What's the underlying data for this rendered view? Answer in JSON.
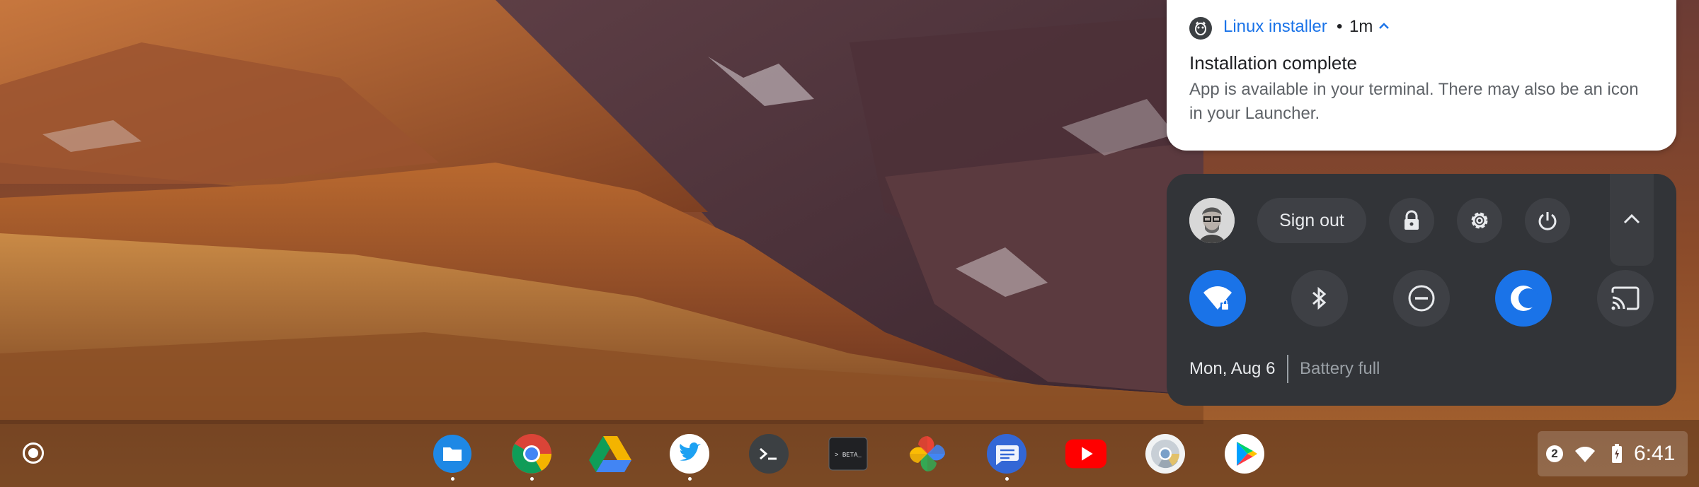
{
  "wallpaper": {
    "description_colors": [
      "#8a4a24",
      "#5a3530",
      "#c98246"
    ]
  },
  "notification": {
    "app_name": "Linux installer",
    "separator": "•",
    "time": "1m",
    "title": "Installation complete",
    "body": "App is available in your terminal. There may also be an icon in your Launcher.",
    "accent": "#1a73e8"
  },
  "quick_settings": {
    "sign_out_label": "Sign out",
    "buttons": [
      "lock-icon",
      "settings-icon",
      "power-icon",
      "chevron-up-icon"
    ],
    "tiles": [
      {
        "name": "wifi",
        "on": true
      },
      {
        "name": "bluetooth",
        "on": false
      },
      {
        "name": "do-not-disturb",
        "on": false
      },
      {
        "name": "night-light",
        "on": true
      },
      {
        "name": "cast",
        "on": false
      }
    ],
    "date": "Mon, Aug 6",
    "battery": "Battery full"
  },
  "shelf": {
    "apps": [
      {
        "name": "files",
        "running": true
      },
      {
        "name": "chrome",
        "running": true
      },
      {
        "name": "google-drive",
        "running": false
      },
      {
        "name": "twitter",
        "running": true
      },
      {
        "name": "terminal",
        "running": false
      },
      {
        "name": "terminal-beta",
        "running": false,
        "text": "> BETA_"
      },
      {
        "name": "google-photos",
        "running": false
      },
      {
        "name": "messages",
        "running": true
      },
      {
        "name": "youtube",
        "running": false
      },
      {
        "name": "chrome-canary",
        "running": false
      },
      {
        "name": "play-store",
        "running": false
      }
    ],
    "status": {
      "notification_count": "2",
      "time": "6:41"
    }
  }
}
